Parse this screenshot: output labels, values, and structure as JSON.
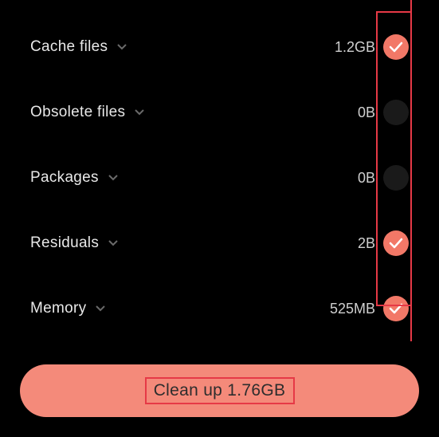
{
  "items": [
    {
      "label": "Cache files",
      "size": "1.2GB",
      "checked": true
    },
    {
      "label": "Obsolete files",
      "size": "0B",
      "checked": false
    },
    {
      "label": "Packages",
      "size": "0B",
      "checked": false
    },
    {
      "label": "Residuals",
      "size": "2B",
      "checked": true
    },
    {
      "label": "Memory",
      "size": "525MB",
      "checked": true
    }
  ],
  "button": {
    "label": "Clean up 1.76GB"
  },
  "colors": {
    "accent": "#f48a7a",
    "checkbox_on": "#f27867",
    "annotation": "#e63946"
  }
}
